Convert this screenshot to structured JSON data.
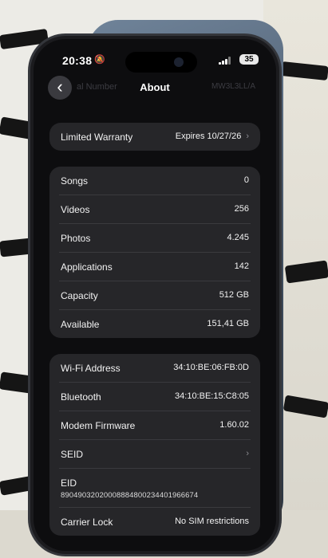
{
  "status": {
    "time": "20:38",
    "battery": "35"
  },
  "nav": {
    "title": "About",
    "ghost_left": "al Number",
    "ghost_right": "MW3L3LL/A"
  },
  "warranty": {
    "label": "Limited Warranty",
    "value": "Expires 10/27/26"
  },
  "media": [
    {
      "label": "Songs",
      "value": "0"
    },
    {
      "label": "Videos",
      "value": "256"
    },
    {
      "label": "Photos",
      "value": "4.245"
    },
    {
      "label": "Applications",
      "value": "142"
    },
    {
      "label": "Capacity",
      "value": "512 GB"
    },
    {
      "label": "Available",
      "value": "151,41 GB"
    }
  ],
  "network": {
    "wifi": {
      "label": "Wi-Fi Address",
      "value": "34:10:BE:06:FB:0D"
    },
    "bluetooth": {
      "label": "Bluetooth",
      "value": "34:10:BE:15:C8:05"
    },
    "modem": {
      "label": "Modem Firmware",
      "value": "1.60.02"
    },
    "seid": {
      "label": "SEID"
    },
    "eid": {
      "label": "EID",
      "value": "89049032020008884800234401966674"
    },
    "carrier": {
      "label": "Carrier Lock",
      "value": "No SIM restrictions"
    }
  }
}
